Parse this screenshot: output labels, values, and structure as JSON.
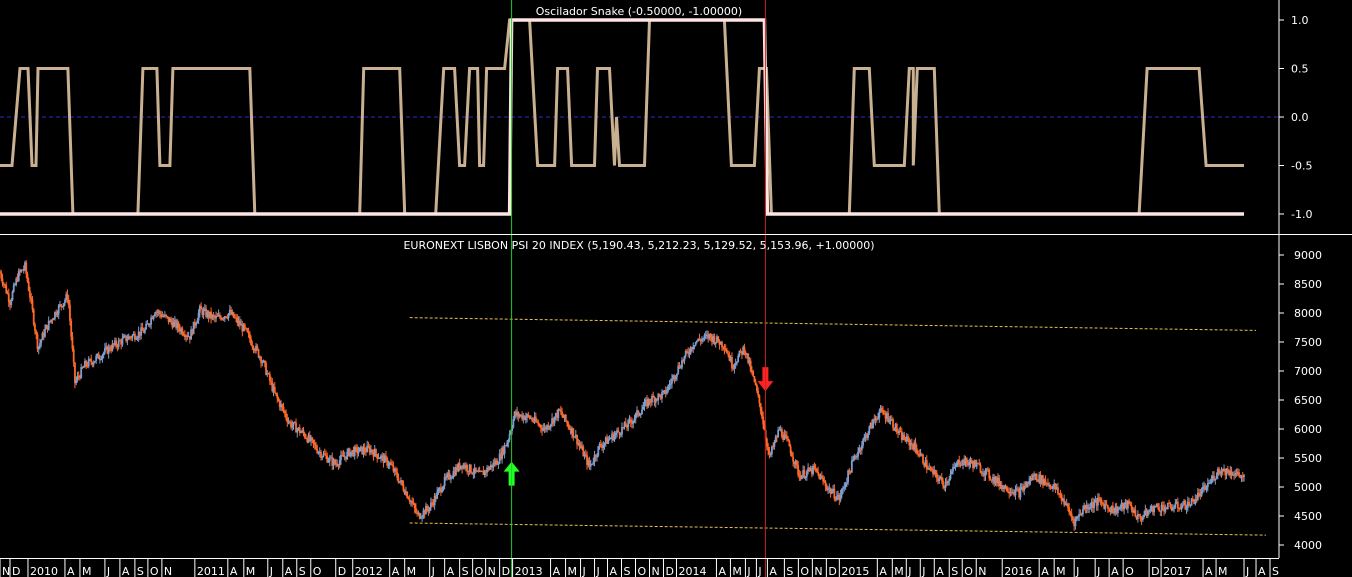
{
  "chart_data": [
    {
      "type": "line",
      "title": "Oscilador Snake (-0.50000, -1.00000)",
      "ylim": [
        -1.2,
        1.2
      ],
      "yticks": [
        1.0,
        0.5,
        0.0,
        -0.5,
        -1.0
      ],
      "ytick_labels": [
        "1.0",
        "0.5",
        "0.0",
        "-0.5",
        "-1.0"
      ],
      "zero_line": true,
      "series": [
        {
          "color": "#c8b090",
          "x_unit": "bar index (0-1280)",
          "points": [
            [
              0,
              -0.5
            ],
            [
              12,
              -0.5
            ],
            [
              20,
              0.5
            ],
            [
              28,
              0.5
            ],
            [
              32,
              -0.5
            ],
            [
              36,
              -0.5
            ],
            [
              38,
              0.5
            ],
            [
              68,
              0.5
            ],
            [
              73,
              -1
            ],
            [
              138,
              -1
            ],
            [
              143,
              0.5
            ],
            [
              157,
              0.5
            ],
            [
              160,
              -0.5
            ],
            [
              170,
              -0.5
            ],
            [
              173,
              0.5
            ],
            [
              250,
              0.5
            ],
            [
              255,
              -1
            ],
            [
              360,
              -1
            ],
            [
              364,
              0.5
            ],
            [
              400,
              0.5
            ],
            [
              405,
              -1
            ],
            [
              436,
              -1
            ],
            [
              444,
              0.5
            ],
            [
              455,
              0.5
            ],
            [
              460,
              -0.5
            ],
            [
              465,
              -0.5
            ],
            [
              470,
              0.5
            ],
            [
              478,
              0.5
            ],
            [
              480,
              -0.5
            ],
            [
              484,
              -0.5
            ],
            [
              487,
              0.5
            ],
            [
              505,
              0.5
            ],
            [
              510,
              1
            ],
            [
              530,
              1
            ],
            [
              538,
              -0.5
            ],
            [
              555,
              -0.5
            ],
            [
              558,
              0.5
            ],
            [
              568,
              0.5
            ],
            [
              572,
              -0.5
            ],
            [
              595,
              -0.5
            ],
            [
              598,
              0.5
            ],
            [
              610,
              0.5
            ],
            [
              615,
              -0.5
            ],
            [
              617,
              0.0
            ],
            [
              620,
              -0.5
            ],
            [
              645,
              -0.5
            ],
            [
              650,
              1
            ],
            [
              725,
              1
            ],
            [
              732,
              -0.5
            ],
            [
              755,
              -0.5
            ],
            [
              760,
              0.5
            ],
            [
              767,
              0.5
            ],
            [
              772,
              -1
            ],
            [
              850,
              -1
            ],
            [
              855,
              0.5
            ],
            [
              870,
              0.5
            ],
            [
              875,
              -0.5
            ],
            [
              905,
              -0.5
            ],
            [
              910,
              0.5
            ],
            [
              914,
              0.5
            ],
            [
              914,
              -0.5
            ],
            [
              918,
              0.5
            ],
            [
              935,
              0.5
            ],
            [
              940,
              -1
            ],
            [
              1140,
              -1
            ],
            [
              1148,
              0.5
            ],
            [
              1200,
              0.5
            ],
            [
              1207,
              -0.5
            ],
            [
              1245,
              -0.5
            ]
          ]
        },
        {
          "color": "#ffe4e4",
          "x_unit": "bar index (0-1280)",
          "points": [
            [
              0,
              -1
            ],
            [
              510,
              -1
            ],
            [
              512,
              1
            ],
            [
              765,
              1
            ],
            [
              768,
              -1
            ],
            [
              1245,
              -1
            ]
          ]
        }
      ]
    },
    {
      "type": "candlestick",
      "title": "EURONEXT LISBON PSI 20 INDEX (5,190.43, 5,212.23, 5,129.52, 5,153.96, +1.00000)",
      "ylim": [
        3850,
        9150
      ],
      "yticks": [
        9000,
        8500,
        8000,
        7500,
        7000,
        6500,
        6000,
        5500,
        5000,
        4500,
        4000
      ],
      "ytick_labels": [
        "9000",
        "8500",
        "8000",
        "7500",
        "7000",
        "6500",
        "6000",
        "5500",
        "5000",
        "4500",
        "4000"
      ],
      "colors": {
        "up": "#7f9fd0",
        "down": "#ff6a2a"
      },
      "x_unit": "bar index (0-1280)",
      "price_anchors": [
        [
          0,
          8700
        ],
        [
          10,
          8200
        ],
        [
          18,
          8650
        ],
        [
          25,
          8800
        ],
        [
          30,
          8300
        ],
        [
          38,
          7400
        ],
        [
          45,
          7700
        ],
        [
          55,
          8000
        ],
        [
          68,
          8300
        ],
        [
          75,
          6800
        ],
        [
          85,
          7100
        ],
        [
          95,
          7200
        ],
        [
          110,
          7400
        ],
        [
          125,
          7550
        ],
        [
          145,
          7700
        ],
        [
          155,
          8050
        ],
        [
          175,
          7800
        ],
        [
          190,
          7600
        ],
        [
          200,
          8050
        ],
        [
          215,
          7900
        ],
        [
          230,
          8000
        ],
        [
          245,
          7700
        ],
        [
          262,
          7200
        ],
        [
          275,
          6600
        ],
        [
          290,
          6100
        ],
        [
          305,
          5900
        ],
        [
          320,
          5600
        ],
        [
          335,
          5400
        ],
        [
          350,
          5600
        ],
        [
          370,
          5650
        ],
        [
          390,
          5400
        ],
        [
          410,
          4800
        ],
        [
          418,
          4500
        ],
        [
          430,
          4650
        ],
        [
          445,
          5100
        ],
        [
          462,
          5400
        ],
        [
          480,
          5200
        ],
        [
          498,
          5450
        ],
        [
          508,
          5800
        ],
        [
          515,
          6250
        ],
        [
          530,
          6200
        ],
        [
          545,
          6000
        ],
        [
          560,
          6300
        ],
        [
          575,
          5900
        ],
        [
          590,
          5350
        ],
        [
          600,
          5700
        ],
        [
          615,
          5900
        ],
        [
          630,
          6100
        ],
        [
          650,
          6500
        ],
        [
          665,
          6600
        ],
        [
          680,
          7100
        ],
        [
          695,
          7500
        ],
        [
          710,
          7600
        ],
        [
          725,
          7450
        ],
        [
          733,
          7100
        ],
        [
          745,
          7400
        ],
        [
          755,
          6800
        ],
        [
          762,
          6300
        ],
        [
          770,
          5500
        ],
        [
          780,
          6000
        ],
        [
          790,
          5700
        ],
        [
          800,
          5200
        ],
        [
          815,
          5300
        ],
        [
          830,
          4950
        ],
        [
          840,
          4800
        ],
        [
          855,
          5500
        ],
        [
          870,
          6000
        ],
        [
          880,
          6300
        ],
        [
          890,
          6200
        ],
        [
          900,
          5900
        ],
        [
          915,
          5700
        ],
        [
          930,
          5300
        ],
        [
          945,
          5050
        ],
        [
          960,
          5450
        ],
        [
          975,
          5400
        ],
        [
          990,
          5200
        ],
        [
          1005,
          5000
        ],
        [
          1020,
          4900
        ],
        [
          1035,
          5200
        ],
        [
          1055,
          5000
        ],
        [
          1065,
          4750
        ],
        [
          1075,
          4400
        ],
        [
          1085,
          4650
        ],
        [
          1100,
          4750
        ],
        [
          1115,
          4600
        ],
        [
          1130,
          4700
        ],
        [
          1140,
          4450
        ],
        [
          1155,
          4650
        ],
        [
          1170,
          4650
        ],
        [
          1190,
          4700
        ],
        [
          1205,
          4950
        ],
        [
          1220,
          5300
        ],
        [
          1235,
          5250
        ],
        [
          1245,
          5154
        ]
      ],
      "trendlines": [
        {
          "color": "#e8c050",
          "from": [
            410,
            7920
          ],
          "to": [
            1257,
            7700
          ]
        },
        {
          "color": "#e8c050",
          "from": [
            410,
            4380
          ],
          "to": [
            1267,
            4170
          ]
        }
      ],
      "signals": [
        {
          "kind": "buy",
          "direction": "up",
          "color": "#22ff22",
          "x": 512,
          "value": 5230
        },
        {
          "kind": "sell",
          "direction": "down",
          "color": "#ff2222",
          "x": 766,
          "value": 6860
        }
      ]
    }
  ],
  "vertical_markers": [
    {
      "x": 512,
      "color": "#22cc22"
    },
    {
      "x": 766,
      "color": "#cc2222"
    }
  ],
  "x_axis": {
    "x_unit": "bar index (0-1280)",
    "labels": [
      {
        "x": 0,
        "t": "N"
      },
      {
        "x": 10,
        "t": "D"
      },
      {
        "x": 28,
        "t": "2010"
      },
      {
        "x": 65,
        "t": "A"
      },
      {
        "x": 80,
        "t": "M"
      },
      {
        "x": 105,
        "t": "J"
      },
      {
        "x": 120,
        "t": "A"
      },
      {
        "x": 135,
        "t": "S"
      },
      {
        "x": 148,
        "t": "O"
      },
      {
        "x": 162,
        "t": "N"
      },
      {
        "x": 195,
        "t": "2011"
      },
      {
        "x": 228,
        "t": "A"
      },
      {
        "x": 244,
        "t": "M"
      },
      {
        "x": 268,
        "t": "J"
      },
      {
        "x": 283,
        "t": "A"
      },
      {
        "x": 297,
        "t": "S"
      },
      {
        "x": 311,
        "t": "O"
      },
      {
        "x": 336,
        "t": "D"
      },
      {
        "x": 353,
        "t": "2012"
      },
      {
        "x": 390,
        "t": "A"
      },
      {
        "x": 405,
        "t": "M"
      },
      {
        "x": 430,
        "t": "J"
      },
      {
        "x": 445,
        "t": "A"
      },
      {
        "x": 460,
        "t": "S"
      },
      {
        "x": 473,
        "t": "O"
      },
      {
        "x": 486,
        "t": "N"
      },
      {
        "x": 500,
        "t": "D"
      },
      {
        "x": 513,
        "t": "2013"
      },
      {
        "x": 551,
        "t": "A"
      },
      {
        "x": 566,
        "t": "M"
      },
      {
        "x": 581,
        "t": "J"
      },
      {
        "x": 595,
        "t": "J"
      },
      {
        "x": 608,
        "t": "A"
      },
      {
        "x": 622,
        "t": "S"
      },
      {
        "x": 636,
        "t": "O"
      },
      {
        "x": 650,
        "t": "N"
      },
      {
        "x": 664,
        "t": "D"
      },
      {
        "x": 677,
        "t": "2014"
      },
      {
        "x": 717,
        "t": "A"
      },
      {
        "x": 731,
        "t": "M"
      },
      {
        "x": 746,
        "t": "J"
      },
      {
        "x": 757,
        "t": "J"
      },
      {
        "x": 768,
        "t": "A"
      },
      {
        "x": 785,
        "t": "S"
      },
      {
        "x": 799,
        "t": "O"
      },
      {
        "x": 813,
        "t": "N"
      },
      {
        "x": 827,
        "t": "D"
      },
      {
        "x": 840,
        "t": "2015"
      },
      {
        "x": 878,
        "t": "A"
      },
      {
        "x": 893,
        "t": "M"
      },
      {
        "x": 907,
        "t": "J"
      },
      {
        "x": 921,
        "t": "J"
      },
      {
        "x": 935,
        "t": "A"
      },
      {
        "x": 950,
        "t": "S"
      },
      {
        "x": 963,
        "t": "O"
      },
      {
        "x": 977,
        "t": "N"
      },
      {
        "x": 1003,
        "t": "2016"
      },
      {
        "x": 1040,
        "t": "A"
      },
      {
        "x": 1055,
        "t": "M"
      },
      {
        "x": 1075,
        "t": "J"
      },
      {
        "x": 1096,
        "t": "J"
      },
      {
        "x": 1110,
        "t": "A"
      },
      {
        "x": 1124,
        "t": "O"
      },
      {
        "x": 1150,
        "t": "D"
      },
      {
        "x": 1162,
        "t": "2017"
      },
      {
        "x": 1204,
        "t": "A"
      },
      {
        "x": 1217,
        "t": "M"
      },
      {
        "x": 1245,
        "t": "J"
      },
      {
        "x": 1257,
        "t": "A"
      },
      {
        "x": 1271,
        "t": "S"
      }
    ]
  }
}
